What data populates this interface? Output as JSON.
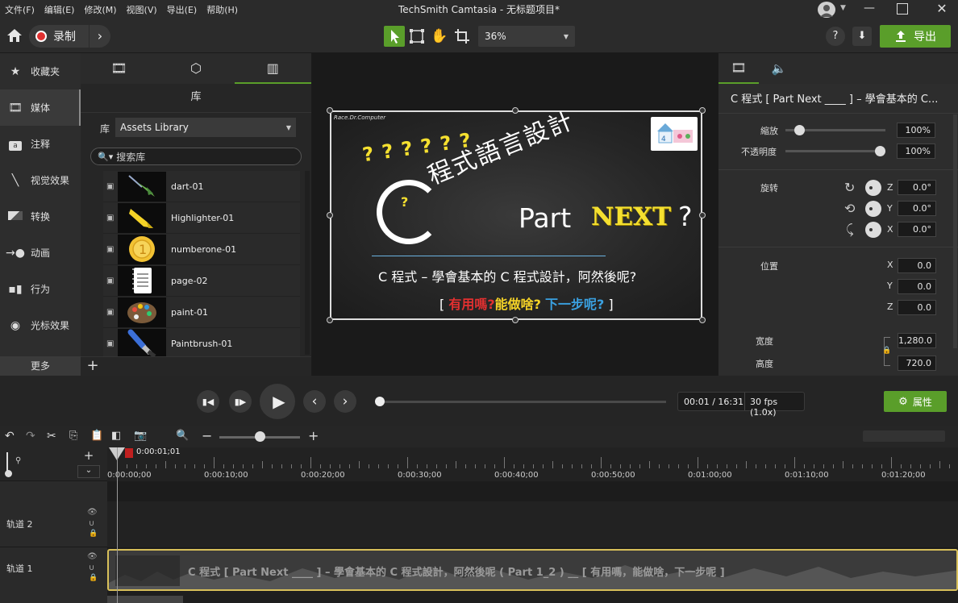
{
  "menu": [
    "文件(F)",
    "编辑(E)",
    "修改(M)",
    "视图(V)",
    "导出(E)",
    "帮助(H)"
  ],
  "window_title": "TechSmith Camtasia - 无标题项目*",
  "toolbar": {
    "record_label": "录制",
    "zoom": "36%",
    "export_label": "导出"
  },
  "sidebar": {
    "items": [
      {
        "label": "收藏夹",
        "icon": "star-icon"
      },
      {
        "label": "媒体",
        "icon": "film-icon"
      },
      {
        "label": "注释",
        "icon": "annotation-icon"
      },
      {
        "label": "视觉效果",
        "icon": "wand-icon"
      },
      {
        "label": "转换",
        "icon": "transition-icon"
      },
      {
        "label": "动画",
        "icon": "animation-icon"
      },
      {
        "label": "行为",
        "icon": "behavior-icon"
      },
      {
        "label": "光标效果",
        "icon": "cursor-effect-icon"
      }
    ],
    "more_label": "更多"
  },
  "library": {
    "title": "库",
    "select_label": "库",
    "select_value": "Assets Library",
    "search_placeholder": "搜索库",
    "items": [
      "dart-01",
      "Highlighter-01",
      "numberone-01",
      "page-02",
      "paint-01",
      "Paintbrush-01"
    ]
  },
  "canvas": {
    "watermark": "Race.Dr.Computer",
    "question_marks": "? ? ? ? ? ?",
    "main_title": "程式語言設計",
    "part": "Part",
    "next": "NEXT",
    "q": "?",
    "subtitle": "C 程式 – 學會基本的 C 程式設計，阿然後呢?",
    "tag_open": "[",
    "tag_red": "有用嗎?",
    "tag_yellow": "能做啥?",
    "tag_blue": "下一步呢?",
    "tag_close": "]"
  },
  "properties": {
    "clip_title": "C 程式 [ Part Next ____ ] – 學會基本的 C...",
    "scale_label": "縮放",
    "scale_value": "100%",
    "scale_level": 0.1,
    "opacity_label": "不透明度",
    "opacity_value": "100%",
    "opacity_level": 1.0,
    "rotation_label": "旋转",
    "rot_z": "0.0°",
    "rot_y": "0.0°",
    "rot_x": "0.0°",
    "position_label": "位置",
    "pos_x": "0.0",
    "pos_y": "0.0",
    "pos_z": "0.0",
    "width_label": "宽度",
    "width_value": "1,280.0",
    "height_label": "高度",
    "height_value": "720.0",
    "axis_z": "Z",
    "axis_y": "Y",
    "axis_x": "X"
  },
  "playback": {
    "time": "00:01 / 16:31",
    "fps": "30 fps (1.0x)",
    "properties_label": "属性"
  },
  "timeline": {
    "playhead": "0:00:01;01",
    "ticks": [
      "0:00:00;00",
      "0:00:10;00",
      "0:00:20;00",
      "0:00:30;00",
      "0:00:40;00",
      "0:00:50;00",
      "0:01:00;00",
      "0:01:10;00",
      "0:01:20;00"
    ],
    "tracks": [
      "轨道 2",
      "轨道 1"
    ],
    "clip_label": "C 程式 [ Part Next ____ ] – 學會基本的 C 程式設計，阿然後呢 ( Part 1_2 ) __ [ 有用嗎，能做啥，下一步呢 ]"
  }
}
